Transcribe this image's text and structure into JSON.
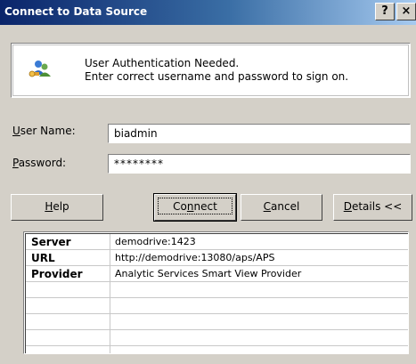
{
  "window": {
    "title": "Connect to Data Source",
    "help_glyph": "?",
    "close_glyph": "×"
  },
  "message": {
    "icon": "users-key-icon",
    "line1": "User Authentication Needed.",
    "line2": "Enter correct username and password to sign on."
  },
  "form": {
    "user_label_mnemonic": "U",
    "user_label_rest": "ser Name:",
    "user_value": "biadmin",
    "password_label_mnemonic": "P",
    "password_label_rest": "assword:",
    "password_value": "********"
  },
  "buttons": {
    "help_mnemonic": "H",
    "help_rest": "elp",
    "connect_pre": "Co",
    "connect_mnemonic": "n",
    "connect_rest": "nect",
    "cancel_mnemonic": "C",
    "cancel_rest": "ancel",
    "details_mnemonic": "D",
    "details_rest": "etails <<"
  },
  "details": {
    "rows": [
      {
        "key": "Server",
        "value": "demodrive:1423"
      },
      {
        "key": "URL",
        "value": "http://demodrive:13080/aps/APS"
      },
      {
        "key": "Provider",
        "value": "Analytic Services Smart View Provider"
      },
      {
        "key": "",
        "value": ""
      },
      {
        "key": "",
        "value": ""
      },
      {
        "key": "",
        "value": ""
      },
      {
        "key": "",
        "value": ""
      }
    ]
  }
}
